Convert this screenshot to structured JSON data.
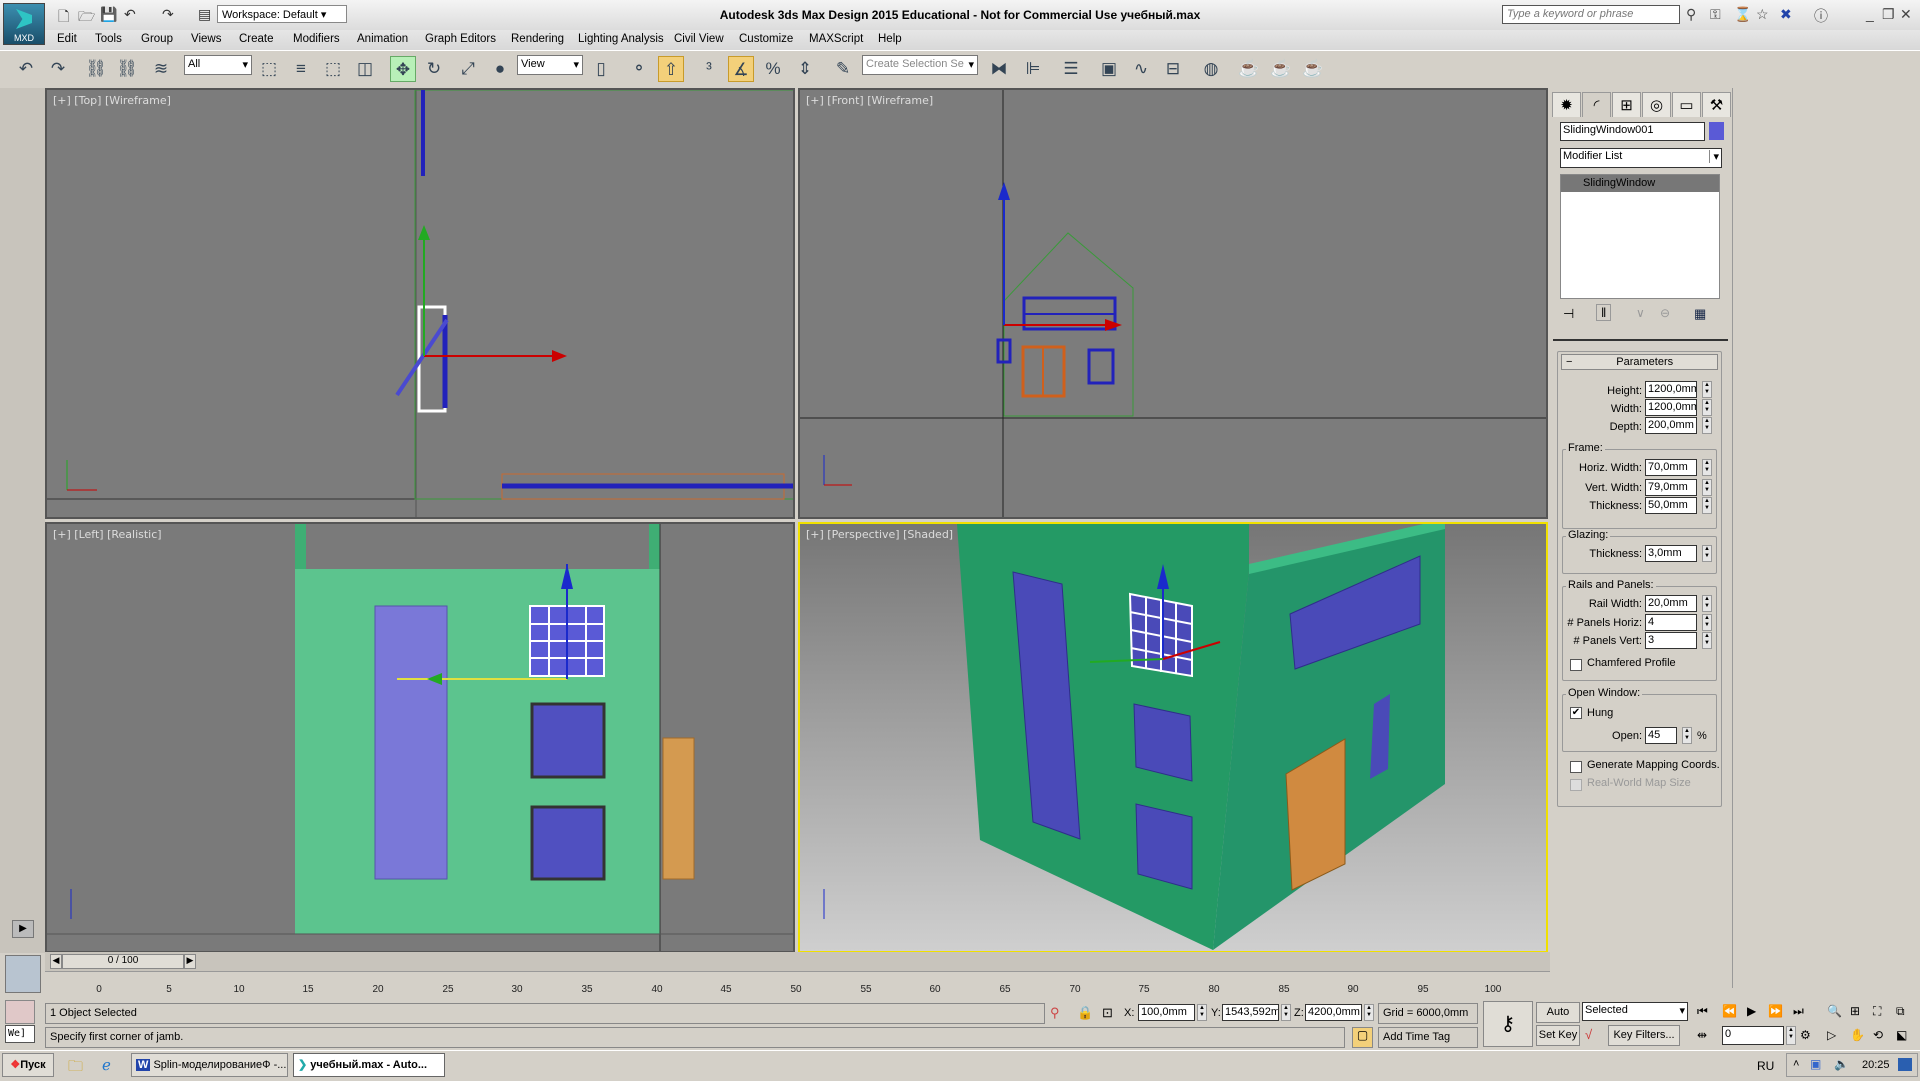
{
  "app": {
    "logo_text": "MXD",
    "title": "Autodesk 3ds Max Design 2015  Educational - Not for Commercial Use    учебный.max",
    "workspace": "Workspace: Default",
    "search_placeholder": "Type a keyword or phrase"
  },
  "menu": [
    "Edit",
    "Tools",
    "Group",
    "Views",
    "Create",
    "Modifiers",
    "Animation",
    "Graph Editors",
    "Rendering",
    "Lighting Analysis",
    "Civil View",
    "Customize",
    "MAXScript",
    "Help"
  ],
  "toolbar": {
    "selection_filter": "All",
    "ref_coord": "View",
    "named_selection_placeholder": "Create Selection Se"
  },
  "viewports": {
    "top": "[+] [Top] [Wireframe]",
    "front": "[+] [Front] [Wireframe]",
    "left": "[+] [Left] [Realistic]",
    "perspective": "[+] [Perspective] [Shaded]"
  },
  "command_panel": {
    "object_name": "SlidingWindow001",
    "object_color": "#5a5ad6",
    "modifier_list": "Modifier List",
    "stack": [
      "SlidingWindow"
    ],
    "rollout_title": "Parameters",
    "params": {
      "height": {
        "label": "Height:",
        "value": "1200,0mm"
      },
      "width": {
        "label": "Width:",
        "value": "1200,0mm"
      },
      "depth": {
        "label": "Depth:",
        "value": "200,0mm"
      }
    },
    "frame": {
      "title": "Frame:",
      "horiz_width": {
        "label": "Horiz. Width:",
        "value": "70,0mm"
      },
      "vert_width": {
        "label": "Vert. Width:",
        "value": "79,0mm"
      },
      "thickness": {
        "label": "Thickness:",
        "value": "50,0mm"
      }
    },
    "glazing": {
      "title": "Glazing:",
      "thickness": {
        "label": "Thickness:",
        "value": "3,0mm"
      }
    },
    "rails": {
      "title": "Rails and Panels:",
      "rail_width": {
        "label": "Rail Width:",
        "value": "20,0mm"
      },
      "panels_horiz": {
        "label": "# Panels Horiz:",
        "value": "4"
      },
      "panels_vert": {
        "label": "# Panels Vert:",
        "value": "3"
      },
      "chamfered": {
        "label": "Chamfered Profile",
        "checked": false
      }
    },
    "open_window": {
      "title": "Open Window:",
      "hung": {
        "label": "Hung",
        "checked": true
      },
      "open": {
        "label": "Open:",
        "value": "45",
        "unit": "%"
      }
    },
    "gen_mapping": {
      "label": "Generate Mapping Coords.",
      "checked": false
    },
    "real_world": {
      "label": "Real-World Map Size",
      "checked": false
    }
  },
  "timeline": {
    "frame_display": "0 / 100",
    "ticks": [
      "0",
      "5",
      "10",
      "15",
      "20",
      "25",
      "30",
      "35",
      "40",
      "45",
      "50",
      "55",
      "60",
      "65",
      "70",
      "75",
      "80",
      "85",
      "90",
      "95",
      "100"
    ]
  },
  "status": {
    "maxscript": "We]",
    "selection": "1 Object Selected",
    "prompt": "Specify first corner of jamb.",
    "x_label": "X:",
    "x": "100,0mm",
    "y_label": "Y:",
    "y": "1543,592m",
    "z_label": "Z:",
    "z": "4200,0mm",
    "grid": "Grid = 6000,0mm",
    "add_time_tag": "Add Time Tag",
    "auto_key": "Auto Key",
    "set_key": "Set Key",
    "key_mode": "Selected",
    "key_filters": "Key Filters...",
    "current_frame": "0"
  },
  "taskbar": {
    "start": "Пуск",
    "tasks": [
      "Splin-моделированиеФ -...",
      "учебный.max - Auto..."
    ],
    "lang": "RU",
    "clock": "20:25"
  }
}
